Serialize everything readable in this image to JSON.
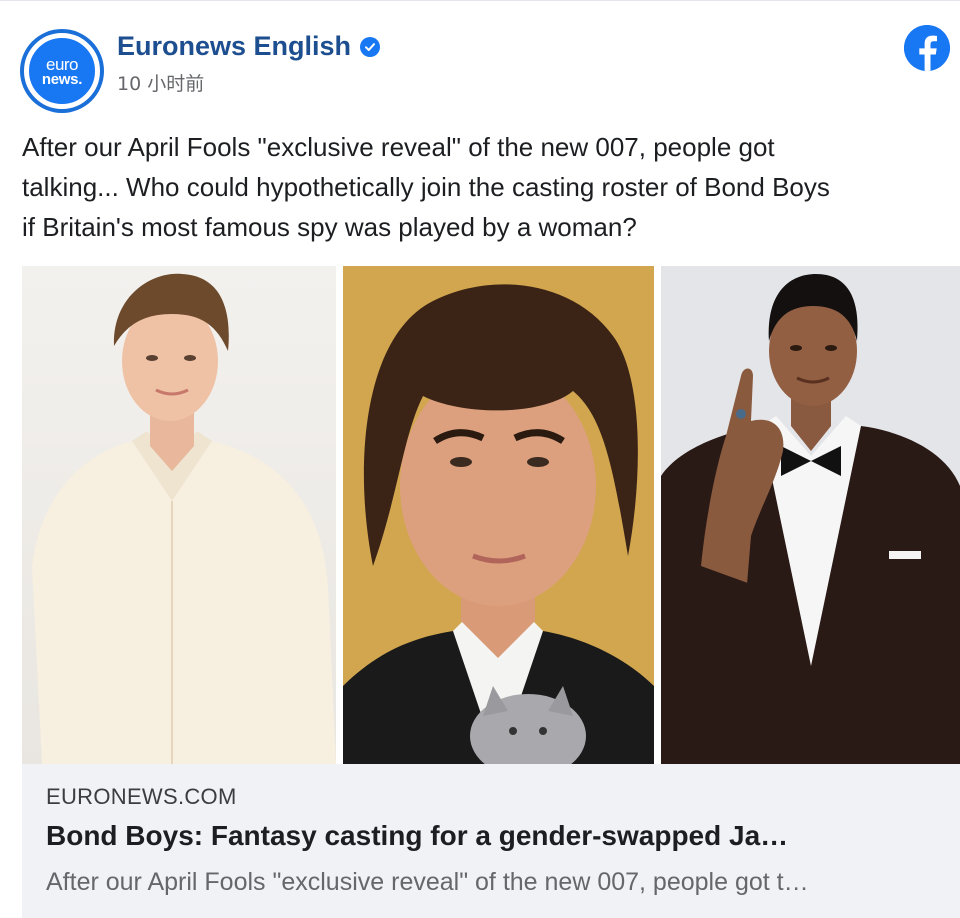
{
  "post": {
    "page_name": "Euronews English",
    "timestamp": "10 小时前",
    "avatar": {
      "line1": "euro",
      "line2": "news."
    },
    "verified_icon": "verified-check-icon",
    "platform_icon": "facebook-icon",
    "caption": "After our April Fools \"exclusive reveal\" of the new 007, people got\ntalking... Who could hypothetically join the casting roster of Bond Boys\nif Britain's most famous spy was played by a woman?",
    "photos": [
      {
        "subject": "man in cream shirt"
      },
      {
        "subject": "man with curly hair and cat"
      },
      {
        "subject": "man in tuxedo pointing"
      }
    ]
  },
  "link_preview": {
    "domain": "EURONEWS.COM",
    "title": "Bond Boys: Fantasy casting for a gender-swapped Ja…",
    "description": "After our April Fools \"exclusive reveal\" of the new 007, people got t…"
  },
  "colors": {
    "brand_blue": "#1877f2",
    "page_name": "#1d4e8f",
    "link_box_bg": "#f0f2f5",
    "secondary_text": "#65676b"
  }
}
